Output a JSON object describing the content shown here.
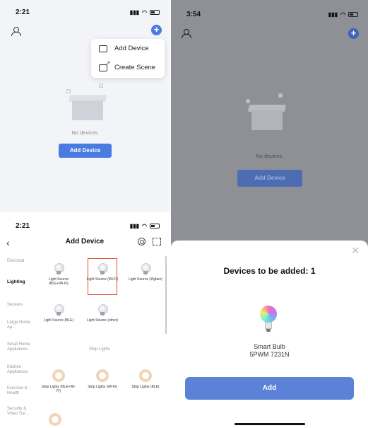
{
  "panel1": {
    "status_time": "2:21",
    "menu": {
      "add_device": "Add Device",
      "create_scene": "Create Scene"
    },
    "empty_text": "No devices",
    "add_device_button": "Add Device"
  },
  "panel2": {
    "status_time": "2:21",
    "title": "Add Device",
    "categories": [
      "Electrical",
      "Lighting",
      "Sensors",
      "Large Home Ap...",
      "Small Home Appliances",
      "Kitchen Appliances",
      "Exercise & Health",
      "Security & Video Sur..."
    ],
    "devices": [
      "Light Source (BLE+Wi-Fi)",
      "Light Source (Wi-Fi)",
      "Light Source (Zigbee)",
      "Light Source (BLE)",
      "Light Source (other)"
    ],
    "section_strip": "Strip Lights",
    "strips": [
      "Strip Lights (BLE+Wi-Fi)",
      "Strip Lights (Wi-Fi)",
      "Strip Lights (BLE)"
    ]
  },
  "panel3": {
    "status_time": "3:54",
    "empty_text": "No devices",
    "add_device_button": "Add Device",
    "sheet_title": "Devices to be added: 1",
    "device_name_line1": "Smart Bulb",
    "device_name_line2": "5PWM 7231N",
    "add_button": "Add"
  }
}
